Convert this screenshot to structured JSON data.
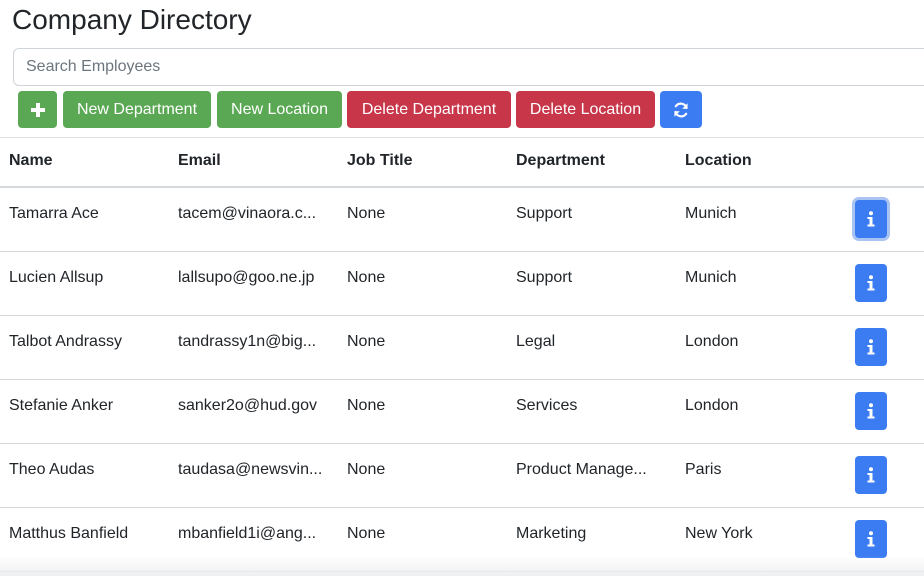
{
  "page": {
    "title": "Company Directory"
  },
  "search": {
    "placeholder": "Search Employees",
    "value": ""
  },
  "toolbar": {
    "add_label": "+",
    "new_department": "New Department",
    "new_location": "New Location",
    "delete_department": "Delete Department",
    "delete_location": "Delete Location",
    "refresh_icon": "refresh-icon"
  },
  "colors": {
    "green": "#5ba854",
    "red": "#c8364a",
    "blue": "#3c7cf3"
  },
  "table": {
    "headers": [
      "Name",
      "Email",
      "Job Title",
      "Department",
      "Location"
    ],
    "rows": [
      {
        "name": "Tamarra Ace",
        "email": "tacem@vinaora.c...",
        "job": "None",
        "department": "Support",
        "location": "Munich"
      },
      {
        "name": "Lucien Allsup",
        "email": "lallsupo@goo.ne.jp",
        "job": "None",
        "department": "Support",
        "location": "Munich"
      },
      {
        "name": "Talbot Andrassy",
        "email": "tandrassy1n@big...",
        "job": "None",
        "department": "Legal",
        "location": "London"
      },
      {
        "name": "Stefanie Anker",
        "email": "sanker2o@hud.gov",
        "job": "None",
        "department": "Services",
        "location": "London"
      },
      {
        "name": "Theo Audas",
        "email": "taudasa@newsvin...",
        "job": "None",
        "department": "Product Manage...",
        "location": "Paris"
      },
      {
        "name": "Matthus Banfield",
        "email": "mbanfield1i@ang...",
        "job": "None",
        "department": "Marketing",
        "location": "New York"
      }
    ]
  }
}
